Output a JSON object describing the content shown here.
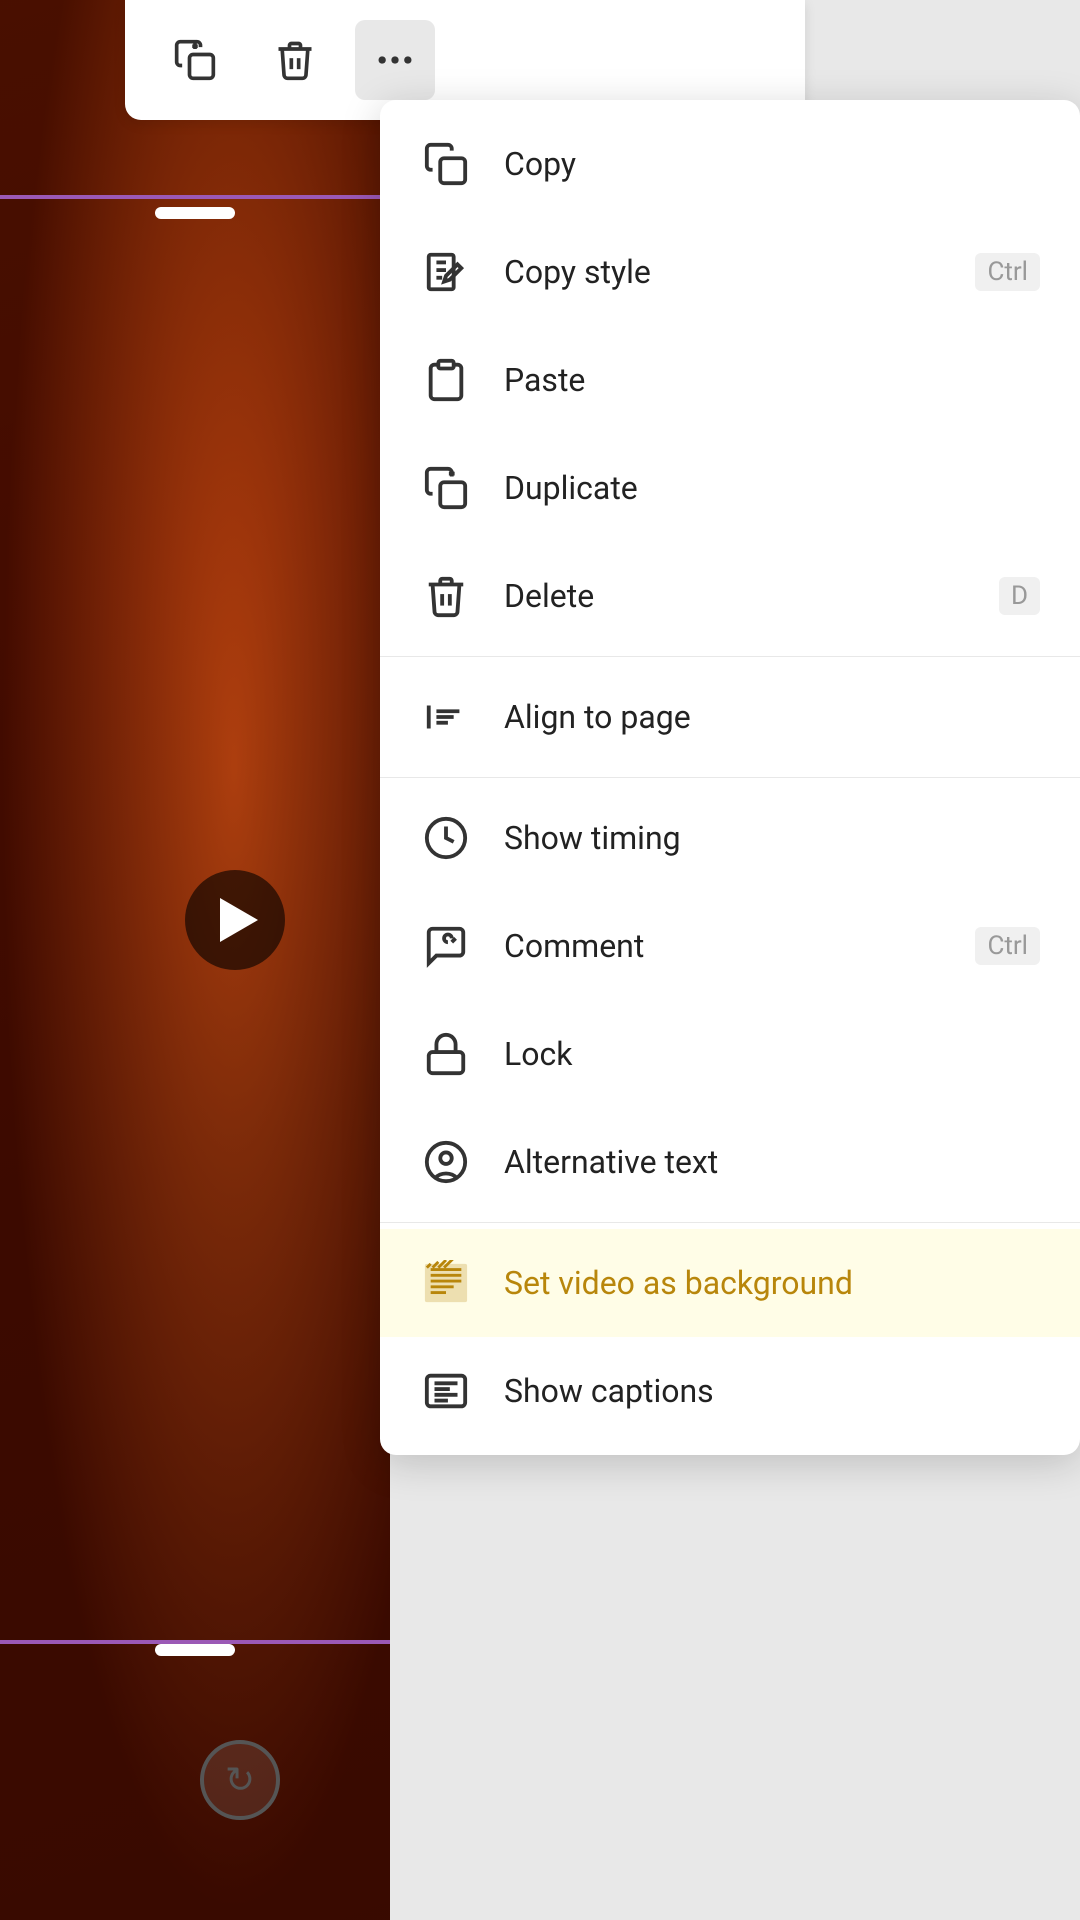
{
  "toolbar": {
    "duplicate_label": "Duplicate",
    "delete_label": "Delete",
    "more_label": "More options"
  },
  "context_menu": {
    "items": [
      {
        "id": "copy",
        "label": "Copy",
        "icon": "copy-icon",
        "shortcut": "",
        "highlighted": false,
        "divider_after": false
      },
      {
        "id": "copy-style",
        "label": "Copy style",
        "icon": "copy-style-icon",
        "shortcut": "Ctrl",
        "highlighted": false,
        "divider_after": false
      },
      {
        "id": "paste",
        "label": "Paste",
        "icon": "paste-icon",
        "shortcut": "",
        "highlighted": false,
        "divider_after": false
      },
      {
        "id": "duplicate",
        "label": "Duplicate",
        "icon": "duplicate-icon",
        "shortcut": "",
        "highlighted": false,
        "divider_after": false
      },
      {
        "id": "delete",
        "label": "Delete",
        "icon": "delete-icon",
        "shortcut": "D",
        "highlighted": false,
        "divider_after": true
      },
      {
        "id": "align-to-page",
        "label": "Align to page",
        "icon": "align-icon",
        "shortcut": "",
        "highlighted": false,
        "divider_after": true
      },
      {
        "id": "show-timing",
        "label": "Show timing",
        "icon": "clock-icon",
        "shortcut": "",
        "highlighted": false,
        "divider_after": false
      },
      {
        "id": "comment",
        "label": "Comment",
        "icon": "comment-icon",
        "shortcut": "Ctrl",
        "highlighted": false,
        "divider_after": false
      },
      {
        "id": "lock",
        "label": "Lock",
        "icon": "lock-icon",
        "shortcut": "",
        "highlighted": false,
        "divider_after": false
      },
      {
        "id": "alternative-text",
        "label": "Alternative text",
        "icon": "alt-text-icon",
        "shortcut": "",
        "highlighted": false,
        "divider_after": true
      },
      {
        "id": "set-video-background",
        "label": "Set video as background",
        "icon": "video-bg-icon",
        "shortcut": "",
        "highlighted": true,
        "divider_after": false
      },
      {
        "id": "show-captions",
        "label": "Show captions",
        "icon": "captions-icon",
        "shortcut": "",
        "highlighted": false,
        "divider_after": false
      }
    ]
  }
}
